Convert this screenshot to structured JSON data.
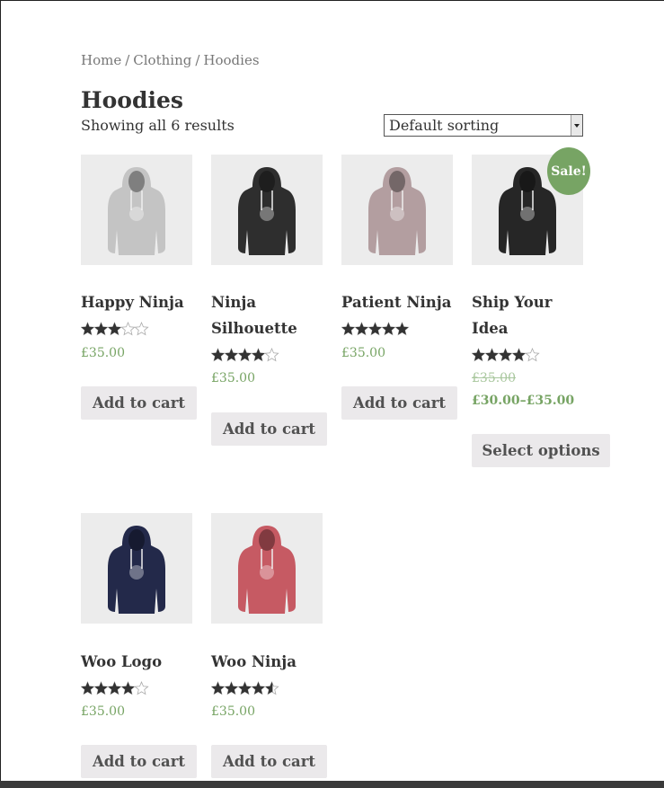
{
  "breadcrumb": {
    "home": "Home",
    "sep1": "/",
    "clothing": "Clothing",
    "sep2": "/",
    "current": "Hoodies"
  },
  "page_title": "Hoodies",
  "result_count": "Showing all 6 results",
  "sorting": {
    "selected": "Default sorting"
  },
  "colors": {
    "accent": "#77a464",
    "button_bg": "#ebe9eb",
    "thumb_bg": "#ececec"
  },
  "products": [
    {
      "title": "Happy Ninja",
      "rating": 3,
      "price": "£35.00",
      "button": "Add to cart",
      "hoodie_color": "#c4c4c4"
    },
    {
      "title": "Ninja Silhouette",
      "rating": 4,
      "price": "£35.00",
      "button": "Add to cart",
      "hoodie_color": "#2e2e2e"
    },
    {
      "title": "Patient Ninja",
      "rating": 5,
      "price": "£35.00",
      "button": "Add to cart",
      "hoodie_color": "#b39ea0"
    },
    {
      "title": "Ship Your Idea",
      "rating": 4,
      "sale": true,
      "badge": "Sale!",
      "price_old": "£35.00",
      "price": "£30.00–£35.00",
      "button": "Select options",
      "hoodie_color": "#262626"
    },
    {
      "title": "Woo Logo",
      "rating": 4,
      "price": "£35.00",
      "button": "Add to cart",
      "hoodie_color": "#23294a"
    },
    {
      "title": "Woo Ninja",
      "rating": 4.5,
      "price": "£35.00",
      "button": "Add to cart",
      "hoodie_color": "#c65a63"
    }
  ]
}
